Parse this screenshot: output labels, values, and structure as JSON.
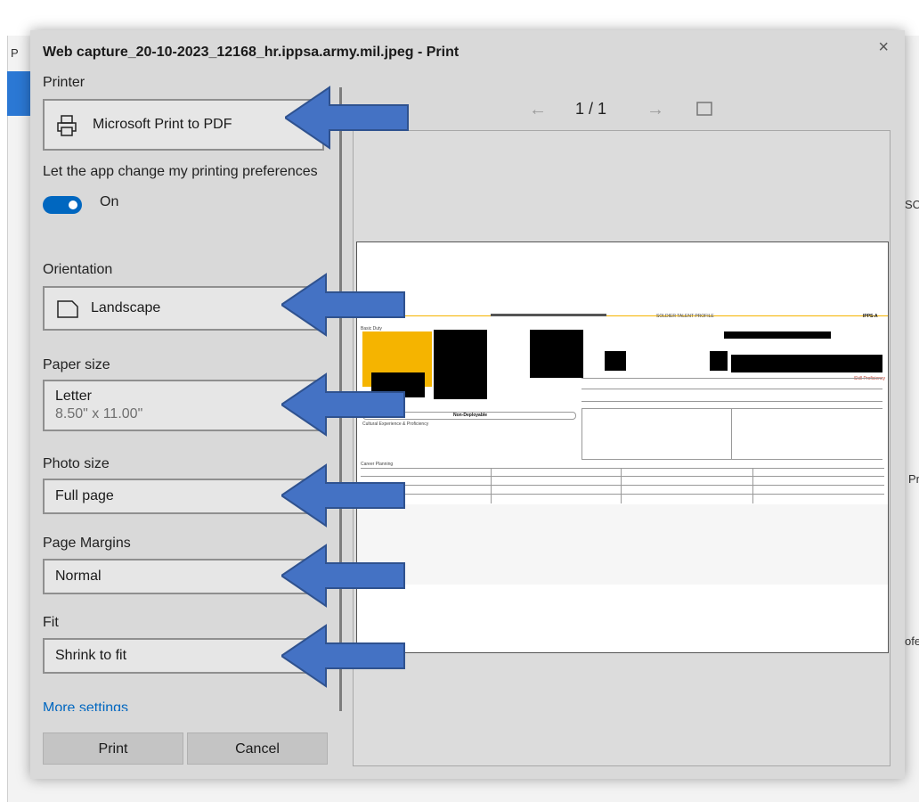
{
  "dialog": {
    "title": "Web capture_20-10-2023_12168_hr.ippsa.army.mil.jpeg - Print",
    "close": "×"
  },
  "printer": {
    "label": "Printer",
    "value": "Microsoft Print to PDF"
  },
  "preferences": {
    "label": "Let the app change my printing preferences",
    "toggle_value": "On"
  },
  "orientation": {
    "label": "Orientation",
    "value": "Landscape"
  },
  "paper_size": {
    "label": "Paper size",
    "value": "Letter",
    "sub": "8.50\" x 11.00\""
  },
  "photo_size": {
    "label": "Photo size",
    "value": "Full page"
  },
  "margins": {
    "label": "Page Margins",
    "value": "Normal"
  },
  "fit": {
    "label": "Fit",
    "value": "Shrink to fit"
  },
  "more_settings": "More settings",
  "buttons": {
    "print": "Print",
    "cancel": "Cancel"
  },
  "preview_nav": {
    "prev": "←",
    "page": "1 / 1",
    "next": "→"
  },
  "preview_doc": {
    "header_title": "SOLDIER TALENT PROFILE",
    "brand": "IPPS-A",
    "basic_duty": "Basic Duty",
    "non_deployable": "Non-Deployable",
    "career_planning": "Career Planning",
    "cultural": "Cultural Experience & Proficiency",
    "skill_profile": "Skill Proficiency"
  },
  "background": {
    "left_letter": "P",
    "right_top": "SC",
    "right_mid": "Pr",
    "right_low": "ofes"
  },
  "colors": {
    "accent": "#0067c0",
    "arrow": "#4472c4",
    "arrow_border": "#2f528f"
  }
}
